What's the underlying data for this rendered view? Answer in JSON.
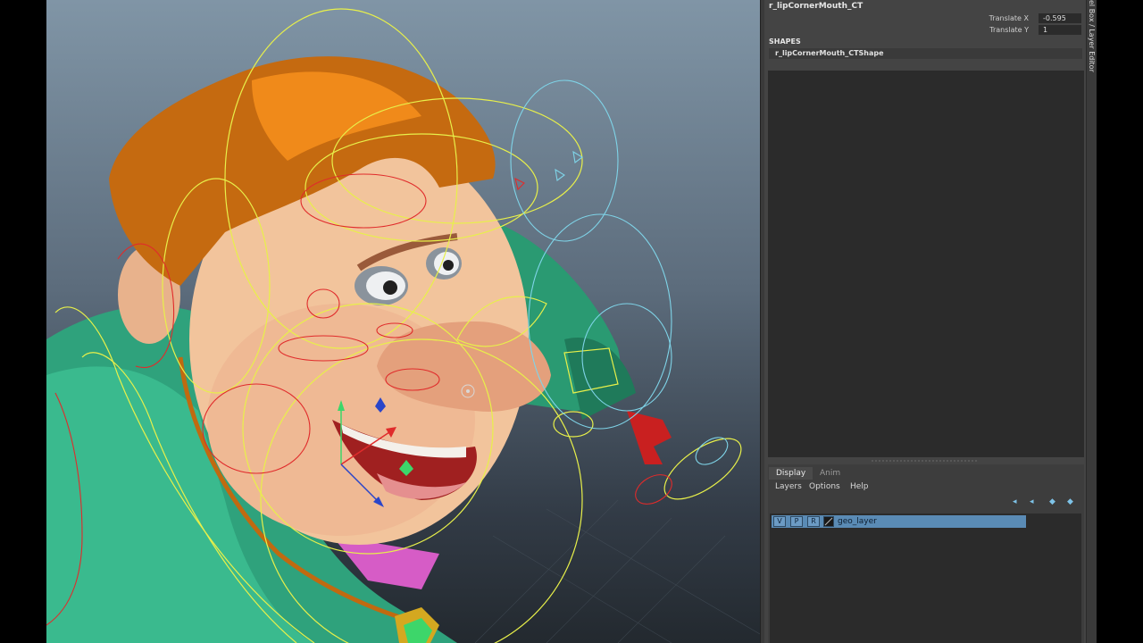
{
  "viewport": {
    "description_icon": "maya-3d-viewport"
  },
  "channel_box": {
    "node_name": "r_lipCornerMouth_CT",
    "attributes": [
      {
        "label": "Translate X",
        "value": "-0.595"
      },
      {
        "label": "Translate Y",
        "value": "1"
      }
    ],
    "shapes_header": "SHAPES",
    "shape_name": "r_lipCornerMouth_CTShape",
    "side_tab": "Channel Box / Layer Editor",
    "side_tab_visible": "el Box / Layer Editor"
  },
  "layer_editor": {
    "tabs": [
      "Display",
      "Anim"
    ],
    "menus": [
      "Layers",
      "Options",
      "Help"
    ],
    "toolbar_icons": [
      "move-layer-up-icon",
      "move-layer-down-icon",
      "new-layer-icon",
      "new-layer-selected-icon"
    ],
    "layers": [
      {
        "v": "V",
        "p": "P",
        "r": "R",
        "name": "geo_layer"
      }
    ]
  },
  "colors": {
    "panel_bg": "#444444",
    "field_bg": "#2b2b2b",
    "selected_layer": "#5a8bb5",
    "control_curve_yellow": "#e8f04a",
    "control_curve_red": "#e02b2b",
    "control_curve_cyan": "#7fd4e8"
  }
}
